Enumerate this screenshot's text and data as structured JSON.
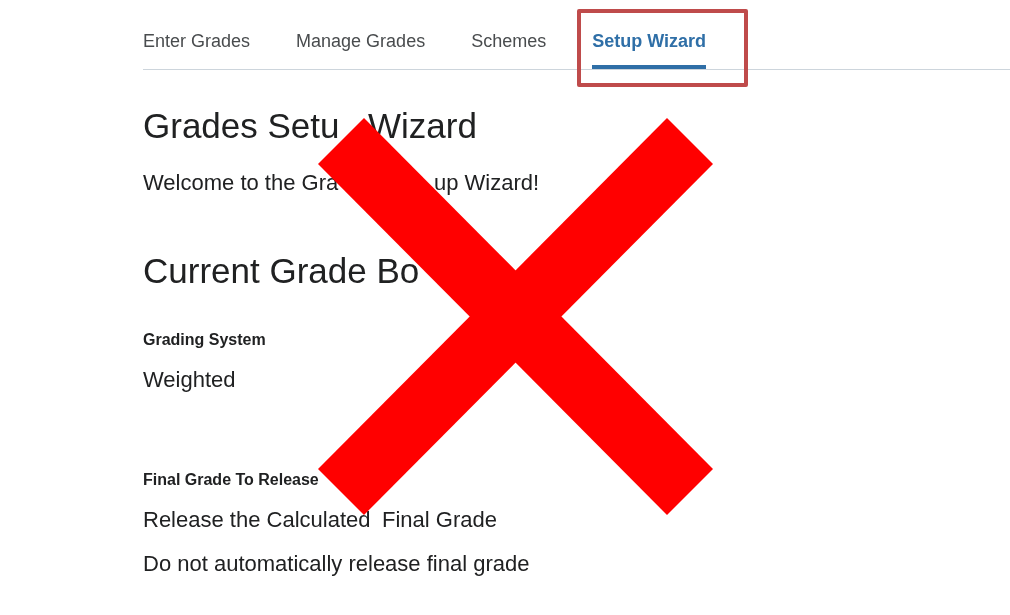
{
  "tabs": [
    {
      "label": "Enter Grades",
      "selected": false
    },
    {
      "label": "Manage Grades",
      "selected": false
    },
    {
      "label": "Schemes",
      "selected": false
    },
    {
      "label": "Setup Wizard",
      "selected": true
    }
  ],
  "title": [
    "Grades Setu",
    "Wizard"
  ],
  "welcome": [
    "Welcome to the Gra",
    "up Wizard!"
  ],
  "section_heading": [
    "Current Grade Bo"
  ],
  "settings": [
    {
      "label": "Grading System",
      "values": [
        [
          "Weighted"
        ]
      ]
    },
    {
      "label": "Final Grade To Release",
      "values": [
        [
          "Release the Calculated",
          "Final Grade"
        ],
        [
          "Do not automatically release final grade"
        ]
      ]
    }
  ]
}
